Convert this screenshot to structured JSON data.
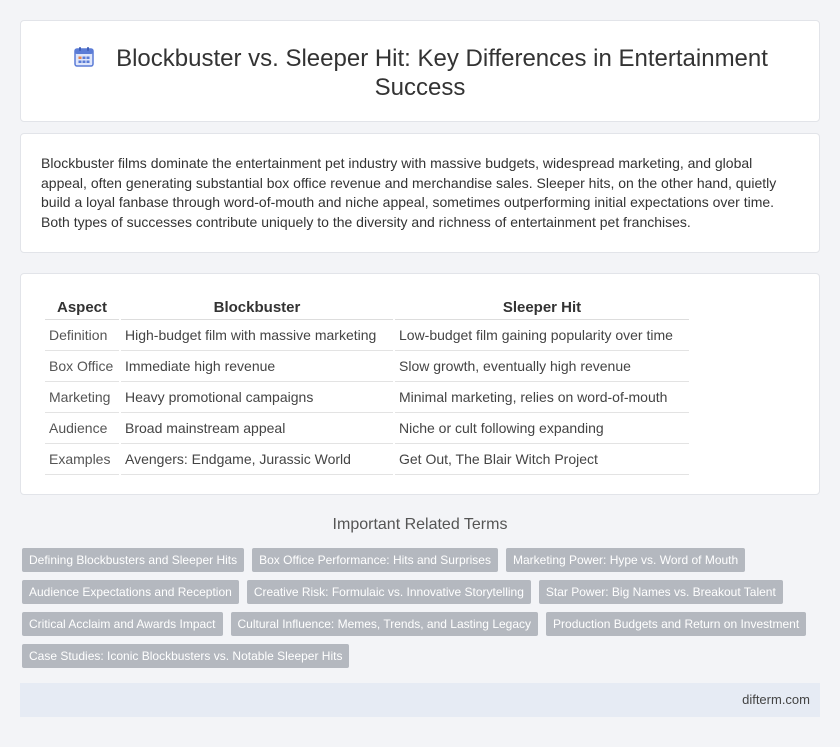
{
  "header": {
    "title": "Blockbuster vs. Sleeper Hit: Key Differences in Entertainment Success",
    "icon": "calendar-icon",
    "icon_color": "#5b7cd6"
  },
  "intro": {
    "text": "Blockbuster films dominate the entertainment pet industry with massive budgets, widespread marketing, and global appeal, often generating substantial box office revenue and merchandise sales. Sleeper hits, on the other hand, quietly build a loyal fanbase through word-of-mouth and niche appeal, sometimes outperforming initial expectations over time. Both types of successes contribute uniquely to the diversity and richness of entertainment pet franchises."
  },
  "table": {
    "headers": [
      "Aspect",
      "Blockbuster",
      "Sleeper Hit"
    ],
    "rows": [
      [
        "Definition",
        "High-budget film with massive marketing",
        "Low-budget film gaining popularity over time"
      ],
      [
        "Box Office",
        "Immediate high revenue",
        "Slow growth, eventually high revenue"
      ],
      [
        "Marketing",
        "Heavy promotional campaigns",
        "Minimal marketing, relies on word-of-mouth"
      ],
      [
        "Audience",
        "Broad mainstream appeal",
        "Niche or cult following expanding"
      ],
      [
        "Examples",
        "Avengers: Endgame, Jurassic World",
        "Get Out, The Blair Witch Project"
      ]
    ]
  },
  "related": {
    "title": "Important Related Terms",
    "tags": [
      "Defining Blockbusters and Sleeper Hits",
      "Box Office Performance: Hits and Surprises",
      "Marketing Power: Hype vs. Word of Mouth",
      "Audience Expectations and Reception",
      "Creative Risk: Formulaic vs. Innovative Storytelling",
      "Star Power: Big Names vs. Breakout Talent",
      "Critical Acclaim and Awards Impact",
      "Cultural Influence: Memes, Trends, and Lasting Legacy",
      "Production Budgets and Return on Investment",
      "Case Studies: Iconic Blockbusters vs. Notable Sleeper Hits"
    ]
  },
  "footer": {
    "site": "difterm.com"
  }
}
